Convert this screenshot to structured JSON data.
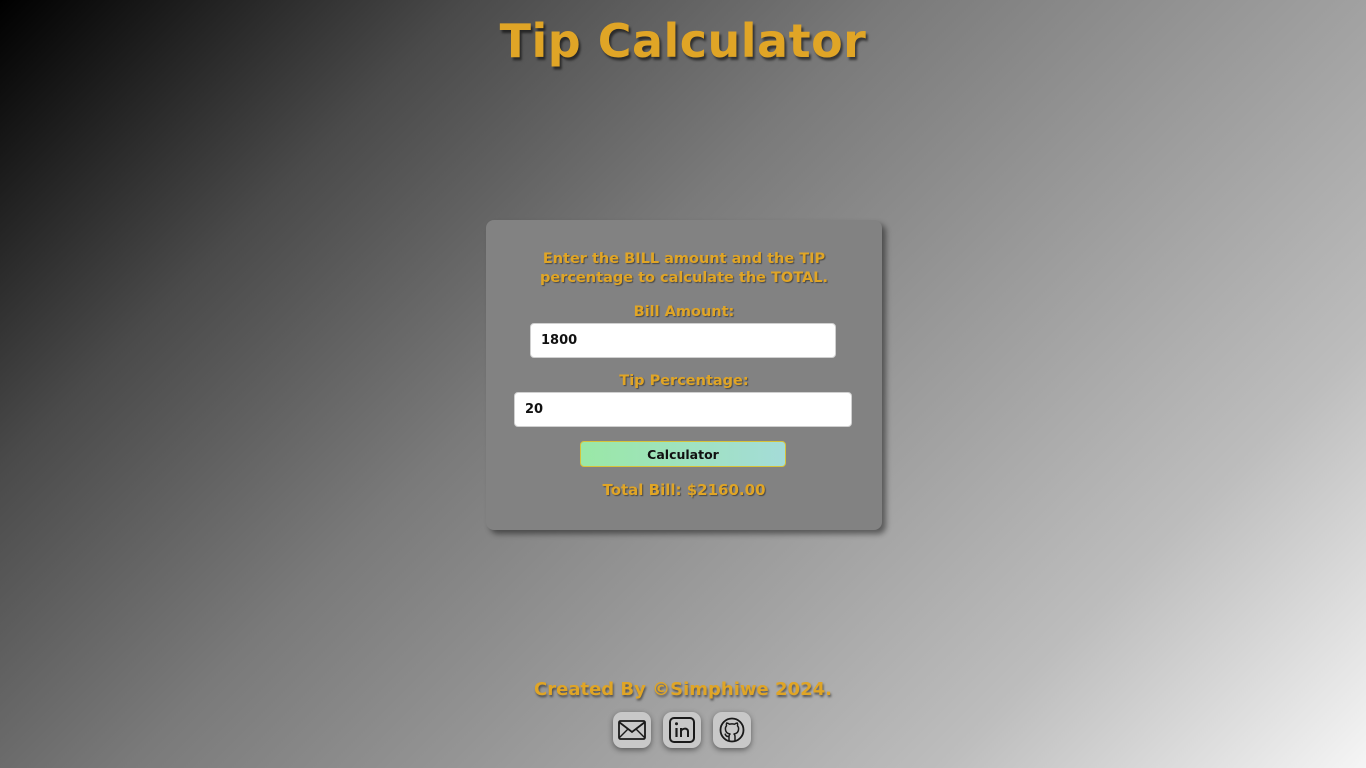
{
  "header": {
    "title": "Tip Calculator"
  },
  "calculator": {
    "instructions_line1": "Enter the BILL amount and the TIP",
    "instructions_line2": "percentage to calculate the TOTAL.",
    "bill_label": "Bill Amount:",
    "bill_value": "1800",
    "tip_label": "Tip Percentage:",
    "tip_value": "20",
    "button_label": "Calculator",
    "total_text": "Total Bill: $2160.00"
  },
  "footer": {
    "credit": "Created By ©Simphiwe 2024.",
    "socials": [
      {
        "icon": "mail-icon"
      },
      {
        "icon": "linkedin-icon"
      },
      {
        "icon": "github-icon"
      }
    ]
  },
  "colors": {
    "accent": "#e0a526",
    "card_background": "#828282",
    "button_gradient_start": "#9ae8a6",
    "button_gradient_end": "#a4dcd8"
  }
}
